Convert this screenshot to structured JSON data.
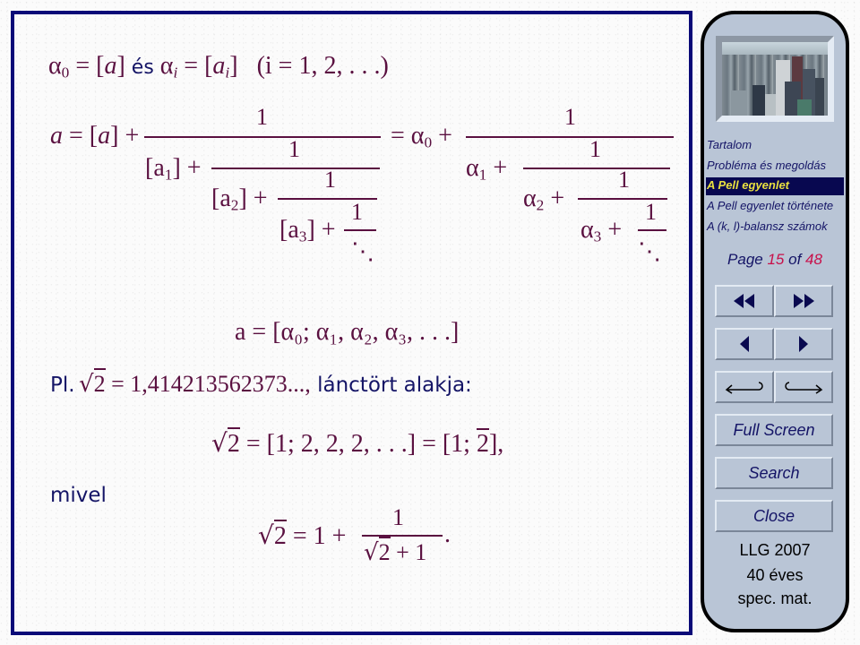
{
  "slide": {
    "line1": {
      "alpha0": "α",
      "sub0": "0",
      "eq1": " = [",
      "a": "a",
      "close1": "]",
      "conj": " és ",
      "alphai": "α",
      "subi": "i",
      "eq2": " = [",
      "ai": "a",
      "ai_sub": "i",
      "close2": "]",
      "cond": "(i = 1, 2, . . .)"
    },
    "cf_left": {
      "lhs": "a = [a] + ",
      "one": "1",
      "row1": "[a",
      "row1_sub": "1",
      "row1_end": "] + ",
      "row2": "[a",
      "row2_sub": "2",
      "row2_end": "] + ",
      "row3": "[a",
      "row3_sub": "3",
      "row3_end": "] + ",
      "dots": "⋱"
    },
    "cf_right": {
      "lhs": "= α",
      "lhs_sub": "0",
      "lhs_end": " + ",
      "one": "1",
      "row1": "α",
      "row1_sub": "1",
      "row1_end": " + ",
      "row2": "α",
      "row2_sub": "2",
      "row2_end": " + ",
      "row3": "α",
      "row3_sub": "3",
      "row3_end": " + ",
      "dots": "⋱"
    },
    "notation": "a = [α₀; α₁, α₂, α₃, . . .]",
    "example_prefix": "Pl.",
    "example_sqrt": "2",
    "example_value": " = 1,414213562373...,",
    "example_suffix": " lánctört alakja:",
    "sqrt2_cf_rad": "2",
    "sqrt2_cf": " = [1; 2, 2, 2, . . .] = [1; ",
    "sqrt2_cf_period": "2",
    "sqrt2_cf_end": "],",
    "since_label": "mivel",
    "identity_rad": "2",
    "identity_mid": " = 1 + ",
    "identity_num": "1",
    "identity_den_rad": "2",
    "identity_den_end": " + 1",
    "identity_end": "."
  },
  "sidebar": {
    "nav": [
      {
        "label": "Tartalom",
        "active": false
      },
      {
        "label": "Probléma és megoldás",
        "active": false
      },
      {
        "label": "A Pell egyenlet",
        "active": true
      },
      {
        "label": "A Pell egyenlet története",
        "active": false
      },
      {
        "label": "A (k, l)-balansz számok",
        "active": false
      }
    ],
    "page": {
      "prefix": "Page",
      "current": "15",
      "of": "of",
      "total": "48"
    },
    "buttons": {
      "first": "first-page",
      "last": "last-page",
      "prev": "previous-page",
      "next": "next-page",
      "back": "go-back",
      "forward": "go-forward",
      "fullscreen": "Full Screen",
      "search": "Search",
      "close": "Close"
    },
    "footer": [
      "LLG 2007",
      "40 éves",
      "spec. mat."
    ]
  },
  "colors": {
    "frame": "#0a0a78",
    "math": "#5a1040",
    "text": "#141466",
    "panel": "#b9c5d6",
    "active_bg": "#080850",
    "active_fg": "#e8e040",
    "page_num": "#c8104a"
  }
}
